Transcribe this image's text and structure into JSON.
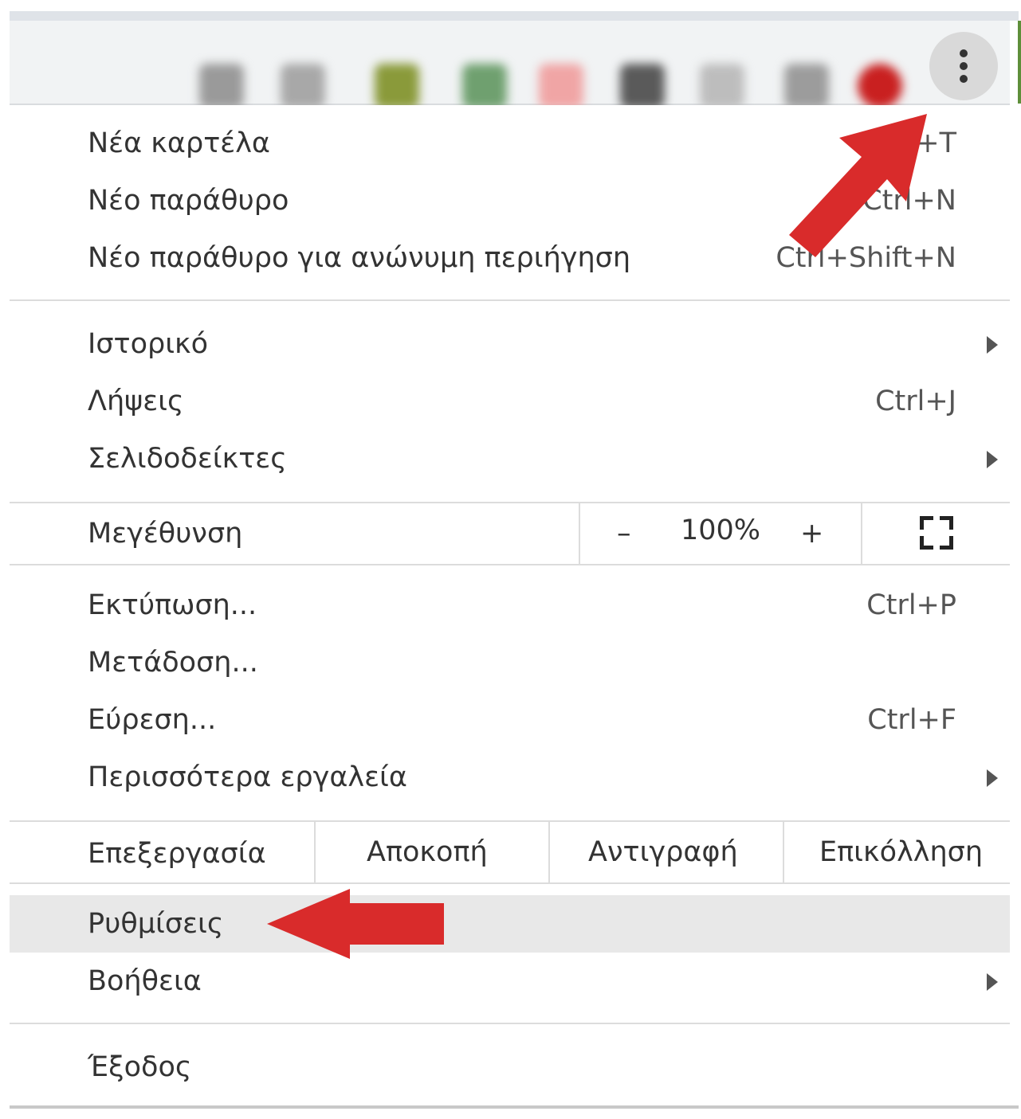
{
  "menu": {
    "new_tab": {
      "label": "Νέα καρτέλα",
      "shortcut": "+T"
    },
    "new_window": {
      "label": "Νέο παράθυρο",
      "shortcut": "Ctrl+N"
    },
    "incognito": {
      "label": "Νέο παράθυρο για ανώνυμη περιήγηση",
      "shortcut": "Ctrl+Shift+N"
    },
    "history": {
      "label": "Ιστορικό"
    },
    "downloads": {
      "label": "Λήψεις",
      "shortcut": "Ctrl+J"
    },
    "bookmarks": {
      "label": "Σελιδοδείκτες"
    },
    "zoom": {
      "label": "Μεγέθυνση",
      "minus": "–",
      "value": "100%",
      "plus": "+"
    },
    "print": {
      "label": "Εκτύπωση...",
      "shortcut": "Ctrl+P"
    },
    "cast": {
      "label": "Μετάδοση..."
    },
    "find": {
      "label": "Εύρεση...",
      "shortcut": "Ctrl+F"
    },
    "more_tools": {
      "label": "Περισσότερα εργαλεία"
    },
    "edit": {
      "label": "Επεξεργασία",
      "cut": "Αποκοπή",
      "copy": "Αντιγραφή",
      "paste": "Επικόλληση"
    },
    "settings": {
      "label": "Ρυθμίσεις"
    },
    "help": {
      "label": "Βοήθεια"
    },
    "exit": {
      "label": "Έξοδος"
    }
  },
  "icons": {
    "menu_button": "vertical-dots-icon",
    "submenu": "triangle-right-icon",
    "fullscreen": "fullscreen-icon"
  },
  "colors": {
    "annotation_arrow": "#d92b2b",
    "highlight": "#e8e8e8"
  }
}
